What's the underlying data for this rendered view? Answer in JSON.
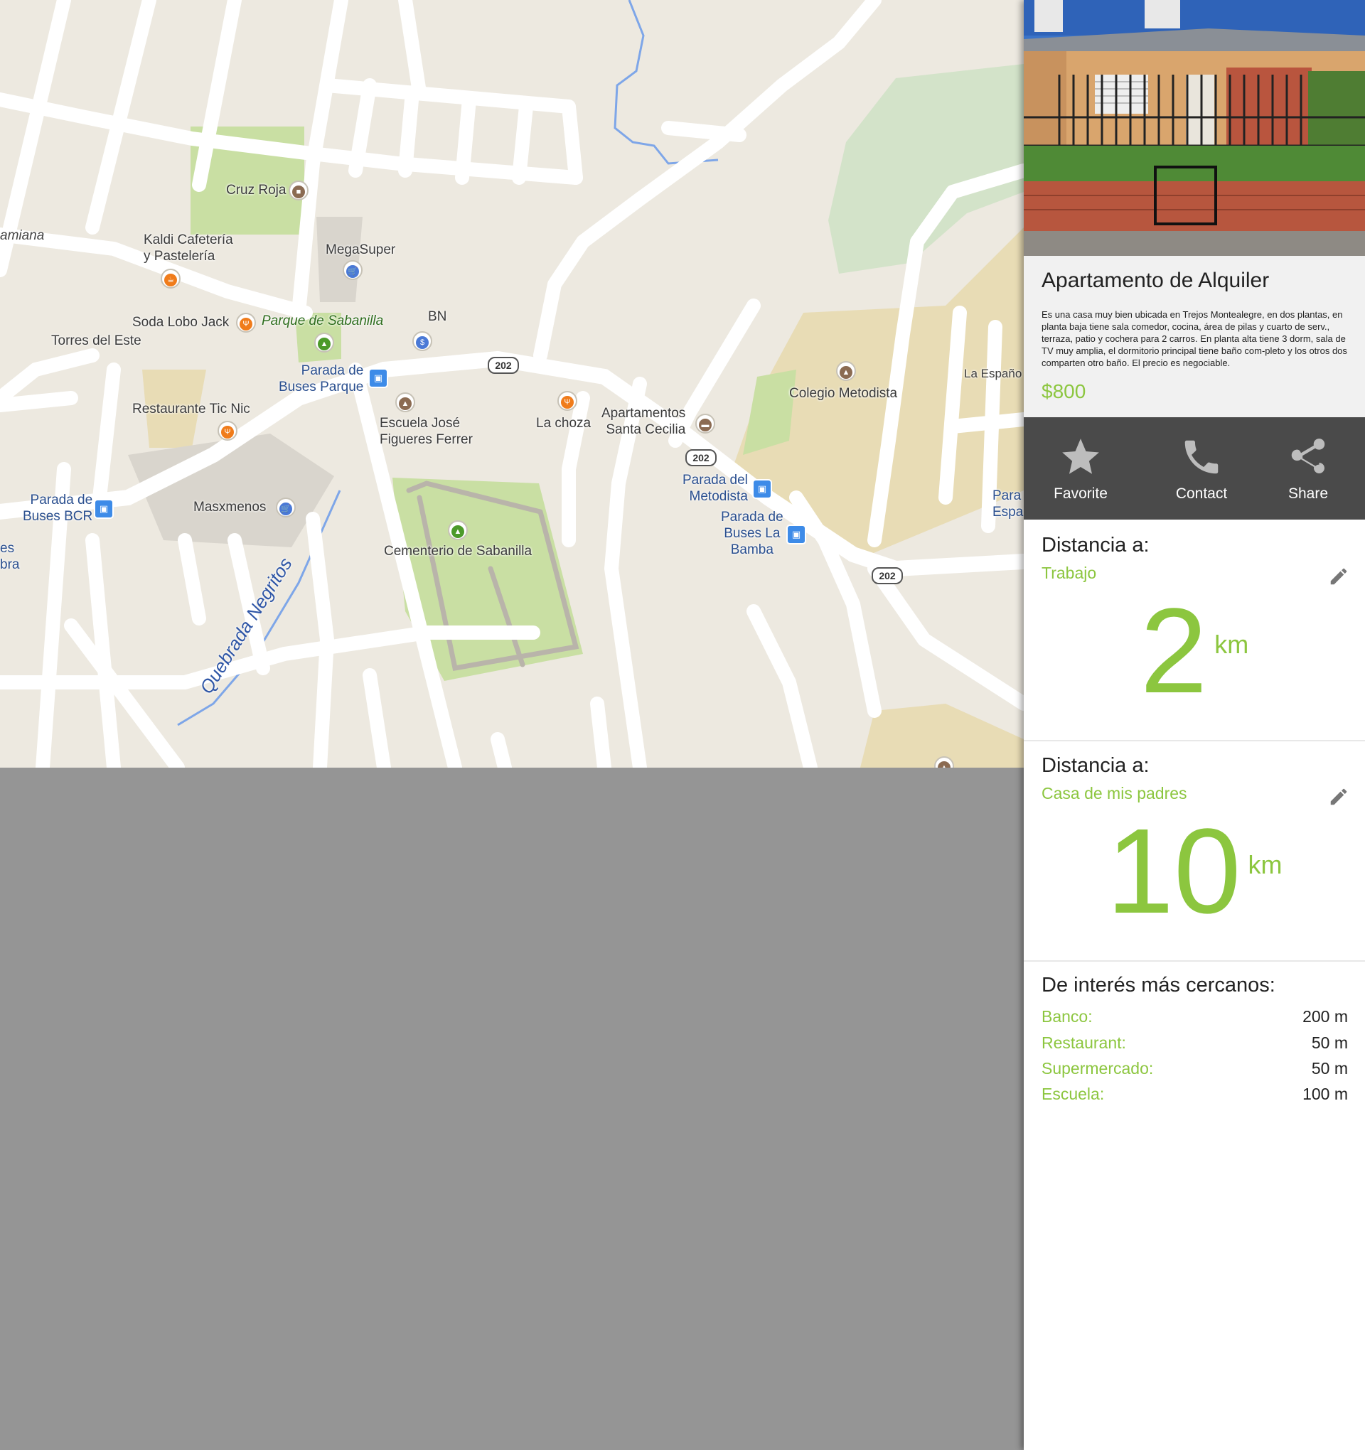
{
  "map": {
    "labels": {
      "cruz_roja": "Cruz Roja",
      "damiana": "amiana",
      "kaldi": "Kaldi Cafetería\ny Pastelería",
      "megasuper": "MegaSuper",
      "soda_lobo": "Soda Lobo Jack",
      "parque_sabanilla": "Parque de Sabanilla",
      "bn": "BN",
      "torres_este": "Torres del Este",
      "parada_parque": "Parada de\nBuses Parque",
      "restaurante_tic": "Restaurante Tic Nic",
      "escuela_jose": "Escuela José\nFigueres Ferrer",
      "la_choza": "La choza",
      "apartamentos": "Apartamentos\nSanta Cecilia",
      "colegio": "Colegio Metodista",
      "la_espanola": "La Españo",
      "parada_bcr": "Parada de\nBuses BCR",
      "masxmenos": "Masxmenos",
      "parada_metodista": "Parada del\nMetodista",
      "parada_bamba": "Parada de\nBuses La\nBamba",
      "parada_espa": "Para\nEspa",
      "cementerio": "Cementerio de Sabanilla",
      "quebrada": "Quebrada Negritos",
      "es_bra": "es\nbra"
    },
    "route_shield": "202"
  },
  "listing": {
    "title": "Apartamento de Alquiler",
    "description": "Es una casa muy bien ubicada en Trejos Montealegre, en dos plantas, en planta baja tiene sala comedor, cocina, área de pilas y cuarto de serv., terraza, patio y cochera para 2 carros. En planta alta tiene 3 dorm, sala de TV muy amplia, el dormitorio principal tiene baño com-pleto y los otros dos comparten otro baño. El precio es negociable.",
    "price": "$800"
  },
  "actions": {
    "favorite": "Favorite",
    "contact": "Contact",
    "share": "Share"
  },
  "distances": [
    {
      "header": "Distancia a:",
      "destination": "Trabajo",
      "value": "2",
      "unit": "km"
    },
    {
      "header": "Distancia a:",
      "destination": "Casa de mis padres",
      "value": "10",
      "unit": "km"
    }
  ],
  "nearby": {
    "header": "De interés más cercanos:",
    "items": [
      {
        "label": "Banco:",
        "value": "200 m"
      },
      {
        "label": "Restaurant:",
        "value": "50 m"
      },
      {
        "label": "Supermercado:",
        "value": "50 m"
      },
      {
        "label": "Escuela:",
        "value": "100 m"
      }
    ]
  },
  "colors": {
    "accent": "#8cc63f",
    "action_bar": "#4a4a4a",
    "info_bg": "#f1f1f1",
    "backdrop": "#959595",
    "map_bg": "#ede9e0"
  }
}
